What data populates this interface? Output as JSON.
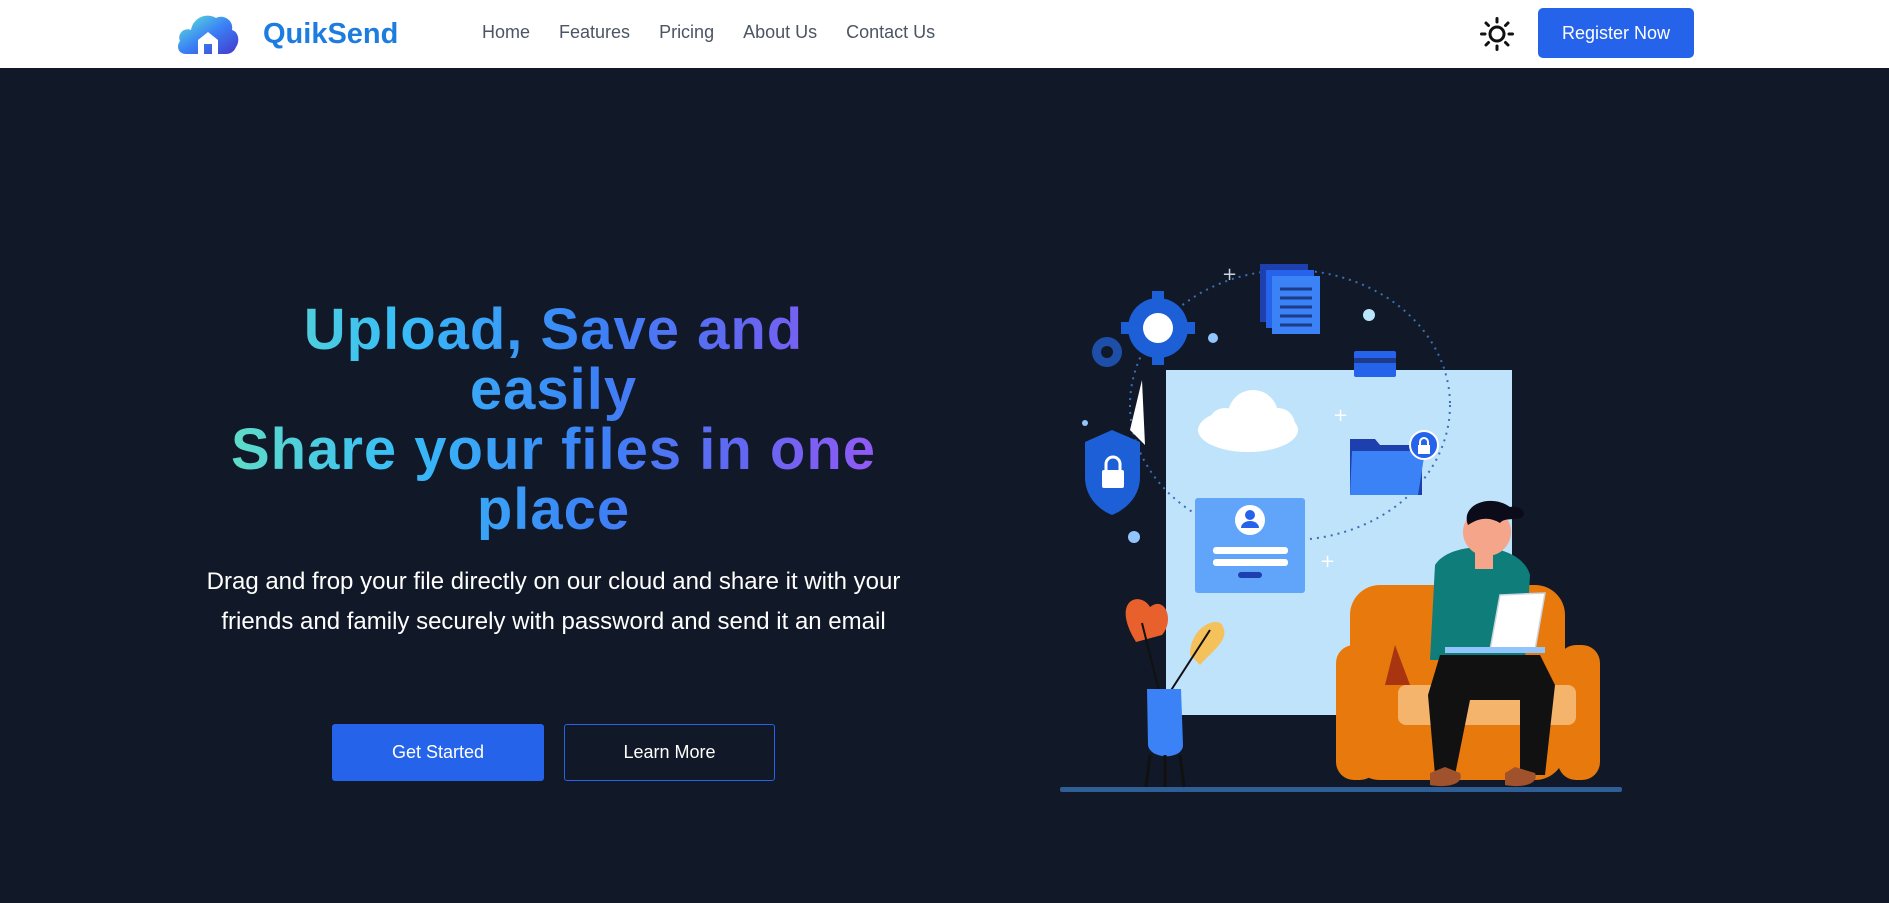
{
  "brand": {
    "name": "QuikSend"
  },
  "nav": {
    "links": [
      "Home",
      "Features",
      "Pricing",
      "About Us",
      "Contact Us"
    ],
    "register_label": "Register Now"
  },
  "hero": {
    "headline_lines": [
      "Upload, Save and",
      "easily",
      "Share your files in one",
      "place"
    ],
    "description": "Drag and frop your file directly on our cloud and share it with your friends and family securely with password and send it an email",
    "get_started_label": "Get Started",
    "learn_more_label": "Learn More"
  },
  "colors": {
    "primary": "#2563eb",
    "brand": "#1d7ce0",
    "background": "#111827",
    "gradient": [
      "#6ee7b7",
      "#38bdf8",
      "#3b82f6",
      "#6366f1",
      "#a855f7"
    ]
  },
  "icons": [
    "cloud-house-logo-icon",
    "sun-icon"
  ]
}
